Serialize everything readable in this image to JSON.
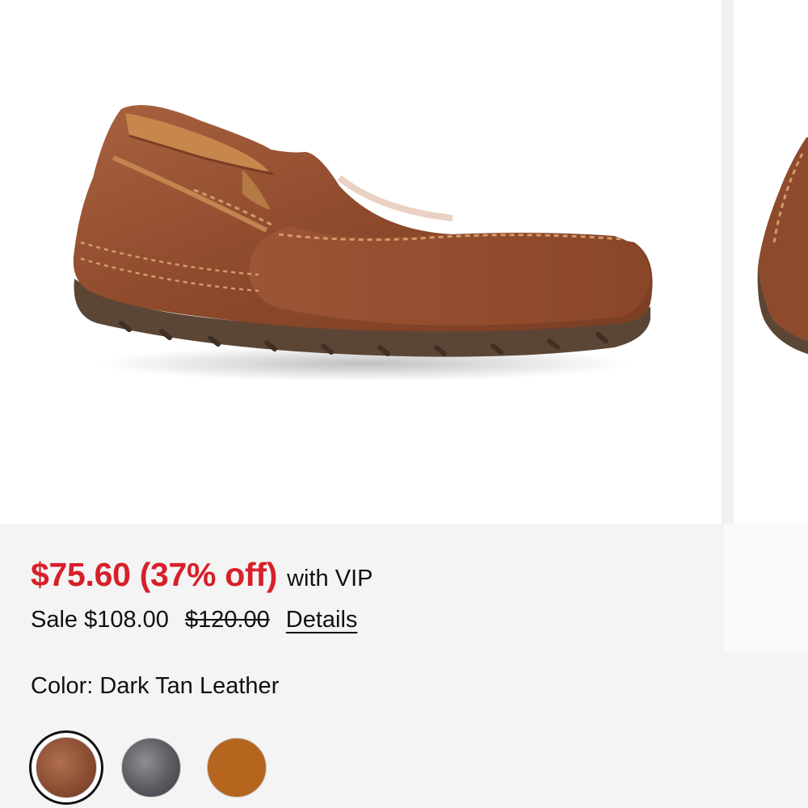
{
  "gallery": {
    "main_image": "product-shoe-image",
    "next_image": "product-shoe-image-peek"
  },
  "pricing": {
    "vip_price": "$75.60 (37% off)",
    "vip_suffix": "with VIP",
    "sale_price": "Sale $108.00",
    "original_price": "$120.00",
    "details_label": "Details"
  },
  "color": {
    "label": "Color: Dark Tan Leather",
    "selected_index": 0,
    "swatches": [
      {
        "name": "swatch-dark-tan-leather",
        "hex": "#8c4e33"
      },
      {
        "name": "swatch-grey",
        "hex": "#5a5b60"
      },
      {
        "name": "swatch-tan",
        "hex": "#b5651d"
      }
    ]
  },
  "colors": {
    "sale_red": "#d7202a",
    "text": "#111111",
    "background": "#f4f4f4"
  }
}
